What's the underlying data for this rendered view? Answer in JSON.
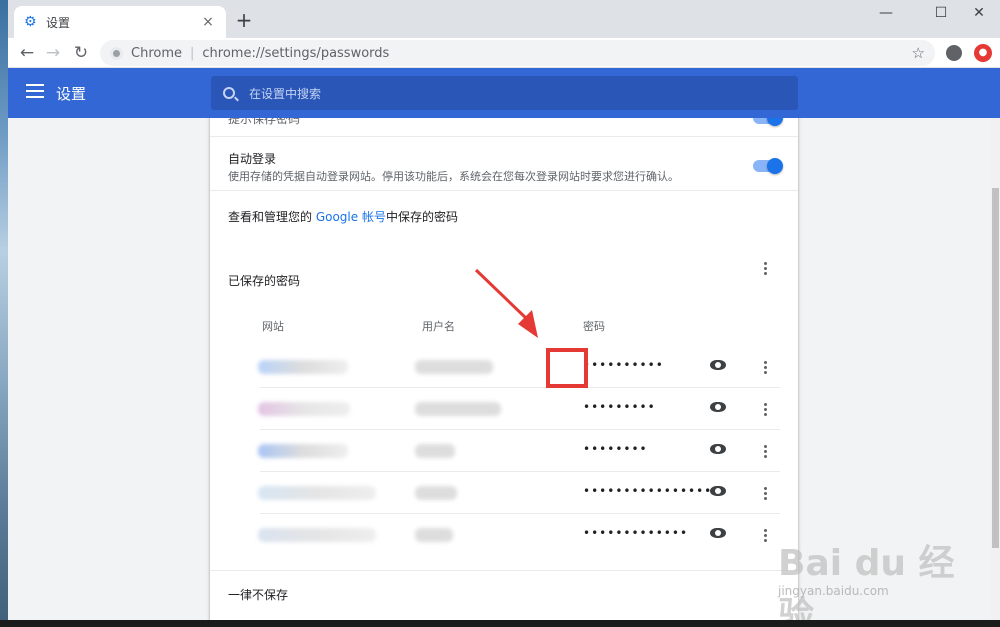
{
  "window": {
    "tab_title": "设置",
    "tab_close": "×",
    "new_tab": "+",
    "minimize": "—",
    "maximize": "☐",
    "close": "✕"
  },
  "toolbar": {
    "origin": "Chrome",
    "separator": "|",
    "url": "chrome://settings/passwords",
    "bookmark_star": "☆",
    "back": "←",
    "forward": "→",
    "reload": "↻"
  },
  "header": {
    "title": "设置",
    "search_placeholder": "在设置中搜索"
  },
  "settings": {
    "offer_save_label": "提示保存密码",
    "autologin_label": "自动登录",
    "autologin_desc": "使用存储的凭据自动登录网站。停用该功能后，系统会在您每次登录网站时要求您进行确认。",
    "google_prefix": "查看和管理您的 ",
    "google_link": "Google 帐号",
    "google_suffix": "中保存的密码",
    "saved_title": "已保存的密码",
    "never_saved_title": "一律不保存"
  },
  "columns": {
    "site": "网站",
    "username": "用户名",
    "password": "密码"
  },
  "passwords": [
    {
      "dots": "••••••••••"
    },
    {
      "dots": "•••••••••"
    },
    {
      "dots": "••••••••"
    },
    {
      "dots": "••••••••••••••••"
    },
    {
      "dots": "•••••••••••••"
    }
  ],
  "watermark": {
    "logo": "Bai du 经验",
    "url": "jingyan.baidu.com"
  },
  "colors": {
    "header_blue": "#3367d6",
    "accent_blue": "#1a73e8",
    "highlight_red": "#e53935"
  }
}
